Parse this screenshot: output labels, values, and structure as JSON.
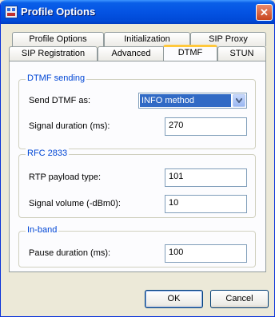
{
  "window": {
    "title": "Profile Options",
    "title_icon": "profile-icon",
    "close_label": "✕"
  },
  "tabs_row1": [
    {
      "label": "Profile Options"
    },
    {
      "label": "Initialization"
    },
    {
      "label": "SIP Proxy"
    }
  ],
  "tabs_row2": [
    {
      "label": "SIP Registration"
    },
    {
      "label": "Advanced"
    },
    {
      "label": "DTMF",
      "active": true
    },
    {
      "label": "STUN"
    }
  ],
  "dtmf_sending": {
    "title": "DTMF sending",
    "send_as_label": "Send DTMF as:",
    "send_as_value": "INFO method",
    "duration_label": "Signal duration (ms):",
    "duration_value": "270"
  },
  "rfc2833": {
    "title": "RFC 2833",
    "payload_label": "RTP payload type:",
    "payload_value": "101",
    "volume_label": "Signal volume (-dBm0):",
    "volume_value": "10"
  },
  "inband": {
    "title": "In-band",
    "pause_label": "Pause duration (ms):",
    "pause_value": "100"
  },
  "buttons": {
    "ok": "OK",
    "cancel": "Cancel"
  },
  "colors": {
    "titlebar": "#0453e3",
    "group_title": "#0046d5",
    "active_tab_accent": "#ffc83c",
    "selection": "#316ac5"
  }
}
